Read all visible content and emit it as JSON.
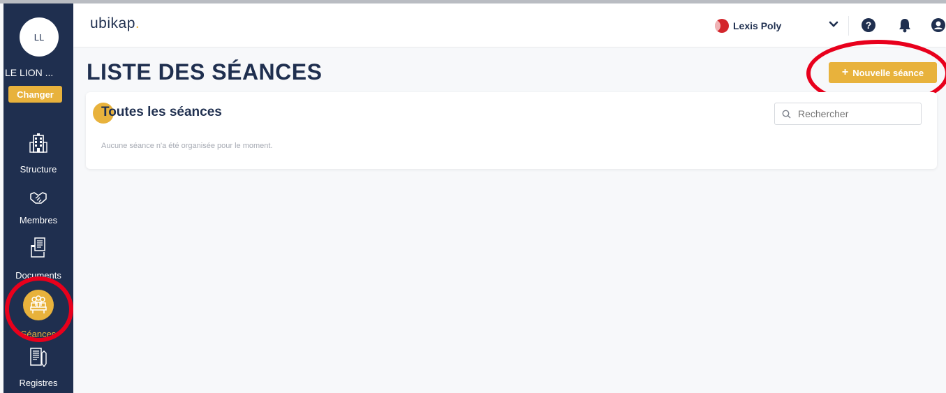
{
  "sidebar": {
    "avatar_initials": "LL",
    "org_name": "LE LION ...",
    "changer_label": "Changer",
    "items": [
      {
        "label": "Structure",
        "icon": "building-icon"
      },
      {
        "label": "Membres",
        "icon": "handshake-icon"
      },
      {
        "label": "Documents",
        "icon": "documents-icon"
      },
      {
        "label": "Séances",
        "icon": "meeting-icon",
        "active": true
      },
      {
        "label": "Registres",
        "icon": "register-icon"
      }
    ]
  },
  "header": {
    "logo_text": "ubikap",
    "logo_dot": ".",
    "account_name": "Lexis Poly",
    "icons": [
      "chevron-down-icon",
      "help-icon",
      "bell-icon",
      "user-icon"
    ]
  },
  "main": {
    "page_title": "LISTE DES SÉANCES",
    "new_button_label": "Nouvelle séance",
    "card_title": "Toutes les séances",
    "search_placeholder": "Rechercher",
    "empty_message": "Aucune séance n'a été organisée pour le moment."
  },
  "colors": {
    "sidebar_bg": "#1f2f4f",
    "accent": "#e8b23c",
    "annotation_red": "#e8001c"
  }
}
